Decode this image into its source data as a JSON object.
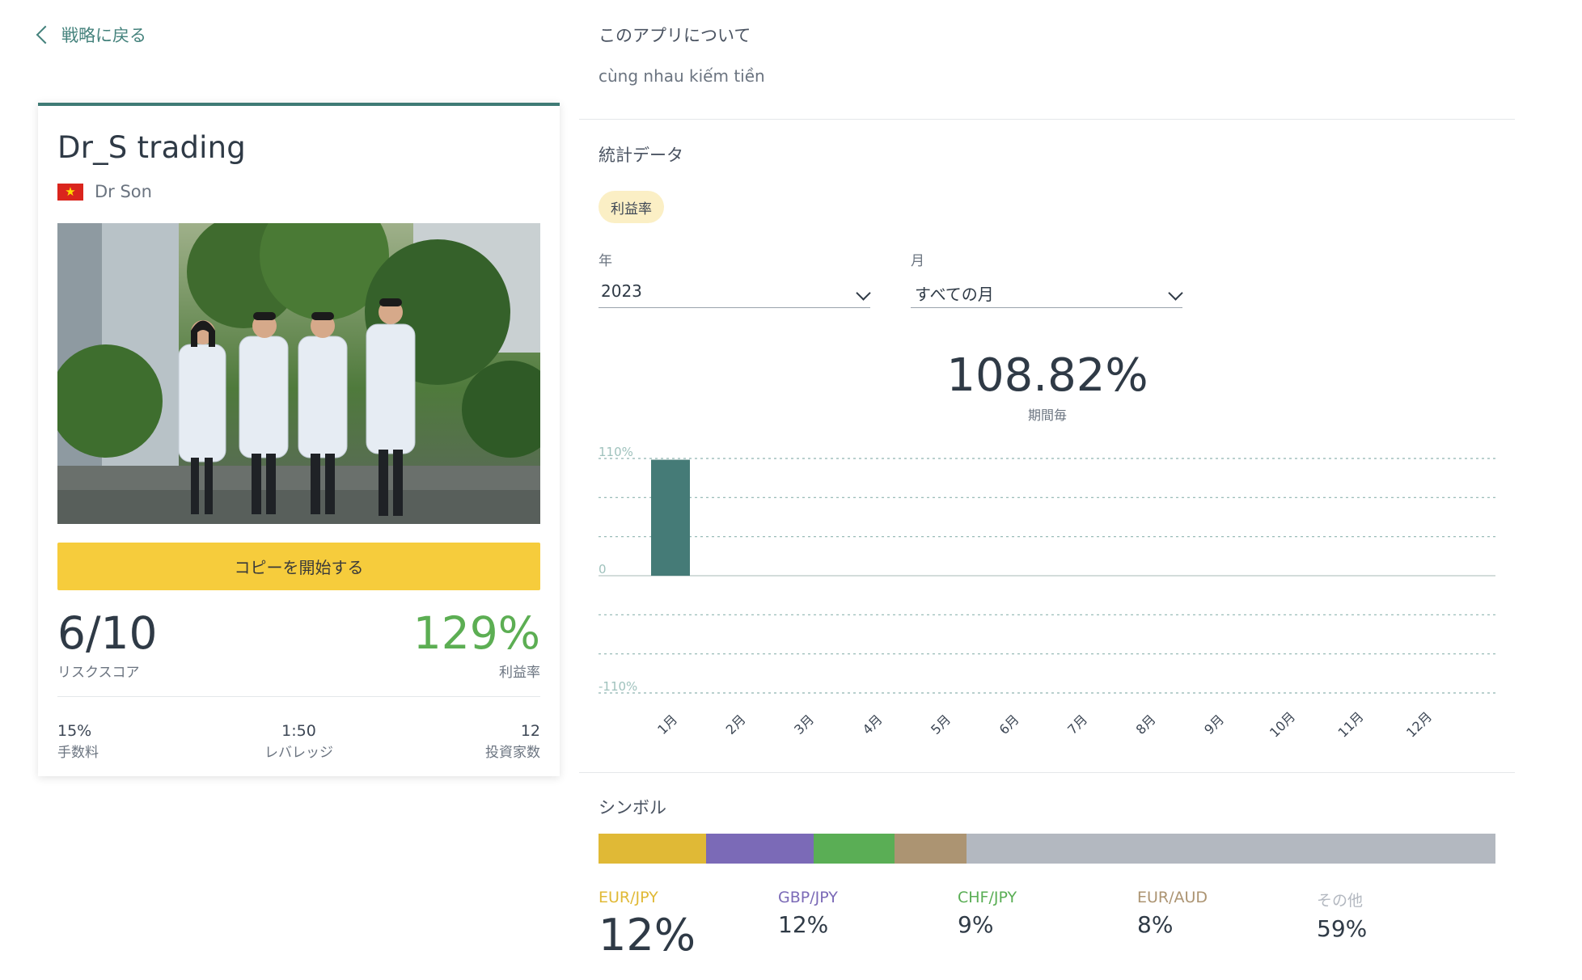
{
  "nav": {
    "back_label": "戦略に戻る"
  },
  "strategy": {
    "title": "Dr_S trading",
    "author": "Dr Son",
    "copy_button": "コピーを開始する",
    "risk_score": "6/10",
    "risk_score_label": "リスクスコア",
    "profit_rate": "129%",
    "profit_rate_label": "利益率",
    "stats": [
      {
        "value": "15%",
        "label": "手数料"
      },
      {
        "value": "1:50",
        "label": "レバレッジ"
      },
      {
        "value": "12",
        "label": "投資家数"
      }
    ]
  },
  "about": {
    "title": "このアプリについて",
    "description": "cùng nhau kiếm tiền"
  },
  "statistics": {
    "title": "統計データ",
    "active_tab": "利益率",
    "year_label": "年",
    "year_value": "2023",
    "month_label": "月",
    "month_value": "すべての月",
    "headline_value": "108.82%",
    "headline_caption": "期間毎"
  },
  "chart_data": {
    "type": "bar",
    "categories": [
      "1月",
      "2月",
      "3月",
      "4月",
      "5月",
      "6月",
      "7月",
      "8月",
      "9月",
      "10月",
      "11月",
      "12月"
    ],
    "values": [
      108.82,
      0,
      0,
      0,
      0,
      0,
      0,
      0,
      0,
      0,
      0,
      0
    ],
    "ylim": [
      -110,
      110
    ],
    "y_tick_labels": [
      "110%",
      "0",
      "-110%"
    ],
    "grid": true,
    "bar_color": "#457b77"
  },
  "symbols": {
    "title": "シンボル",
    "items": [
      {
        "name": "EUR/JPY",
        "percent": "12%",
        "share": 12,
        "color": "#e0b936"
      },
      {
        "name": "GBP/JPY",
        "percent": "12%",
        "share": 12,
        "color": "#7b6ab7"
      },
      {
        "name": "CHF/JPY",
        "percent": "9%",
        "share": 9,
        "color": "#5aae55"
      },
      {
        "name": "EUR/AUD",
        "percent": "8%",
        "share": 8,
        "color": "#ac9472"
      },
      {
        "name": "その他",
        "percent": "59%",
        "share": 59,
        "color": "#b3b8c0"
      }
    ]
  }
}
